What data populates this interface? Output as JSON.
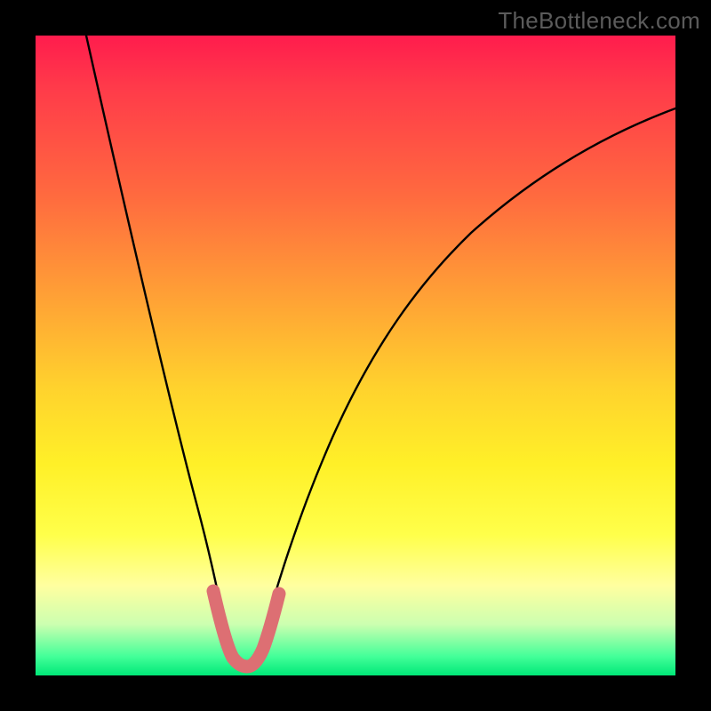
{
  "watermark": "TheBottleneck.com",
  "chart_data": {
    "type": "line",
    "title": "",
    "xlabel": "",
    "ylabel": "",
    "xlim": [
      0,
      100
    ],
    "ylim": [
      0,
      100
    ],
    "series": [
      {
        "name": "curve",
        "x": [
          8,
          12,
          16,
          20,
          24,
          26,
          28,
          30,
          32,
          34,
          36,
          40,
          45,
          50,
          55,
          60,
          65,
          70,
          75,
          80,
          85,
          90,
          95,
          100
        ],
        "values": [
          100,
          80,
          62,
          46,
          32,
          22,
          12,
          5,
          3,
          4,
          10,
          22,
          34,
          44,
          52,
          58,
          63,
          67,
          70,
          72,
          74,
          76,
          77,
          78
        ]
      },
      {
        "name": "highlight",
        "x": [
          26,
          27,
          28,
          29,
          30,
          31,
          32,
          33,
          34,
          35,
          36
        ],
        "values": [
          22,
          16,
          12,
          8,
          5,
          3,
          3,
          4,
          6,
          8,
          10
        ]
      }
    ],
    "highlight_color": "#dd6f73",
    "curve_color": "#000000"
  }
}
